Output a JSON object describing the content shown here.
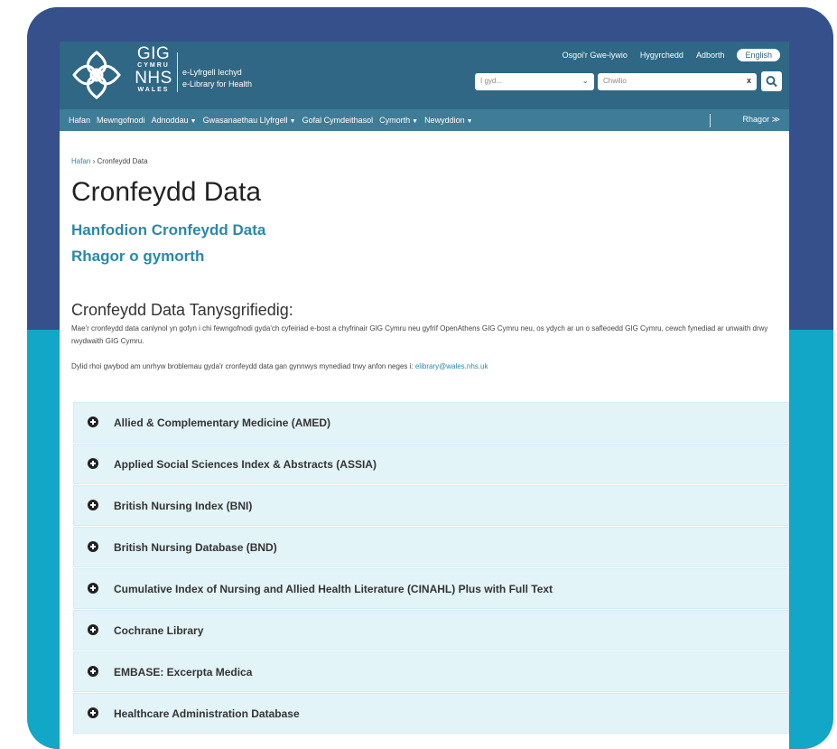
{
  "header": {
    "brand_gig": "GIG",
    "brand_cymru": "CYMRU",
    "brand_nhs": "NHS",
    "brand_wales": "WALES",
    "library_cy": "e-Lyfrgell Iechyd",
    "library_en": "e-Library for Health",
    "links": [
      "Osgoi'r Gwe-lywio",
      "Hygyrchedd",
      "Adborth"
    ],
    "language_button": "English",
    "search_select": "I gyd...",
    "search_placeholder": "Chwilio",
    "search_clear": "x"
  },
  "nav": {
    "items": [
      {
        "label": "Hafan",
        "dropdown": false
      },
      {
        "label": "Mewngofnodi",
        "dropdown": false
      },
      {
        "label": "Adnoddau",
        "dropdown": true
      },
      {
        "label": "Gwasanaethau Llyfrgell",
        "dropdown": true
      },
      {
        "label": "Gofal Cymdeithasol",
        "dropdown": false
      },
      {
        "label": "Cymorth",
        "dropdown": true
      },
      {
        "label": "Newyddion",
        "dropdown": true
      }
    ],
    "more": "Rhagor ≫"
  },
  "breadcrumb": {
    "home": "Hafan",
    "separator": "›",
    "current": "Cronfeydd Data"
  },
  "main": {
    "title": "Cronfeydd Data",
    "link1": "Hanfodion Cronfeydd Data",
    "link2": "Rhagor o gymorth",
    "section_title": "Cronfeydd Data Tanysgrifiedig:",
    "para1": "Mae'r cronfeydd data canlynol yn gofyn i chi fewngofnodi gyda'ch cyfeiriad e-bost a chyfrinair GIG Cymru neu gyfrif OpenAthens GIG Cymru neu, os ydych ar un o safleoedd GIG Cymru, cewch fynediad ar unwaith drwy rwydwaith GIG Cymru.",
    "para2": "Dylid rhoi gwybod am unrhyw broblemau gyda'r cronfeydd data gan gynnwys mynediad trwy anfon neges i:",
    "email": "elibrary@wales.nhs.uk"
  },
  "databases": [
    "Allied & Complementary Medicine (AMED)",
    "Applied Social Sciences Index & Abstracts (ASSIA)",
    "British Nursing Index (BNI)",
    "British Nursing Database (BND)",
    "Cumulative Index of Nursing and Allied Health Literature (CINAHL) Plus with Full Text",
    "Cochrane Library",
    "EMBASE: Excerpta Medica",
    "Healthcare Administration Database"
  ],
  "colors": {
    "header": "#2f6784",
    "nav": "#3f7c97",
    "accent": "#2a89a8",
    "outer_top": "#36508c",
    "outer_bottom": "#12a6c7",
    "accordion": "#e3f4f8"
  },
  "icons": {
    "search": "search-icon",
    "expand": "plus-circle-icon",
    "dropdown": "caret-down-icon"
  }
}
